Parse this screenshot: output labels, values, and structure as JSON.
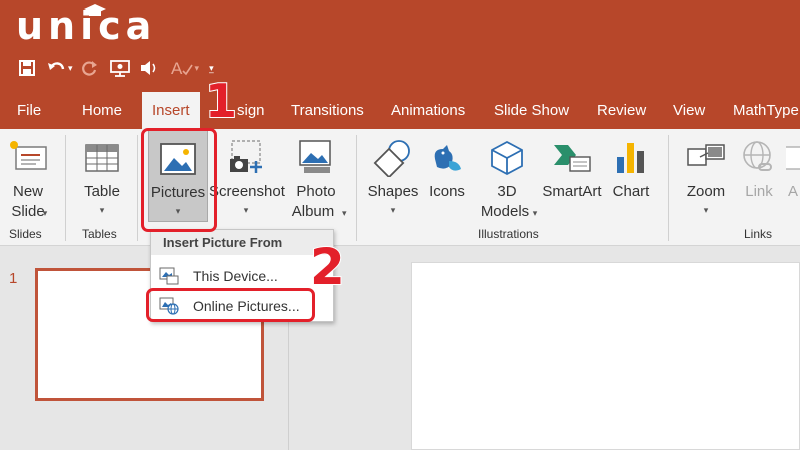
{
  "brand": {
    "logo_text": "unica"
  },
  "quick_access": {
    "icons": [
      "save-icon",
      "undo-icon",
      "redo-icon",
      "present-icon",
      "speaker-icon",
      "font-color-icon",
      "customize-caret-icon"
    ]
  },
  "tabs": [
    {
      "label": "File"
    },
    {
      "label": "Home"
    },
    {
      "label": "Insert",
      "active": true
    },
    {
      "label": "Design",
      "partially_hidden_as": "sign"
    },
    {
      "label": "Transitions"
    },
    {
      "label": "Animations"
    },
    {
      "label": "Slide Show"
    },
    {
      "label": "Review"
    },
    {
      "label": "View"
    },
    {
      "label": "MathType"
    }
  ],
  "tab_labels": {
    "file": "File",
    "home": "Home",
    "insert": "Insert",
    "design_visible": "sign",
    "transitions": "Transitions",
    "animations": "Animations",
    "slideshow": "Slide Show",
    "review": "Review",
    "view": "View",
    "mathtype": "MathType"
  },
  "ribbon": {
    "new_slide": {
      "line1": "New",
      "line2": "Slide"
    },
    "table": {
      "label": "Table"
    },
    "pictures": {
      "label": "Pictures"
    },
    "screenshot": {
      "label": "Screenshot"
    },
    "photo_album": {
      "line1": "Photo",
      "line2": "Album"
    },
    "shapes": {
      "label": "Shapes"
    },
    "icons": {
      "label": "Icons"
    },
    "models_3d": {
      "line1": "3D",
      "line2": "Models"
    },
    "smartart": {
      "label": "SmartArt"
    },
    "chart": {
      "label": "Chart"
    },
    "zoom": {
      "label": "Zoom"
    },
    "link": {
      "label": "Link"
    },
    "action": {
      "label": "A"
    },
    "groups": {
      "slides": "Slides",
      "tables": "Tables",
      "illustrations": "Illustrations",
      "links": "Links"
    }
  },
  "dropdown": {
    "header": "Insert Picture From",
    "items": [
      {
        "label": "This Device..."
      },
      {
        "label": "Online Pictures..."
      }
    ]
  },
  "slides": {
    "thumbnail_number": "1"
  },
  "annotations": {
    "step1": "1",
    "step2": "2"
  },
  "colors": {
    "brand_red": "#b7472a",
    "annotation_red": "#e3202a",
    "ribbon_bg": "#f3f3f3",
    "workspace_bg": "#e6e6e6"
  }
}
